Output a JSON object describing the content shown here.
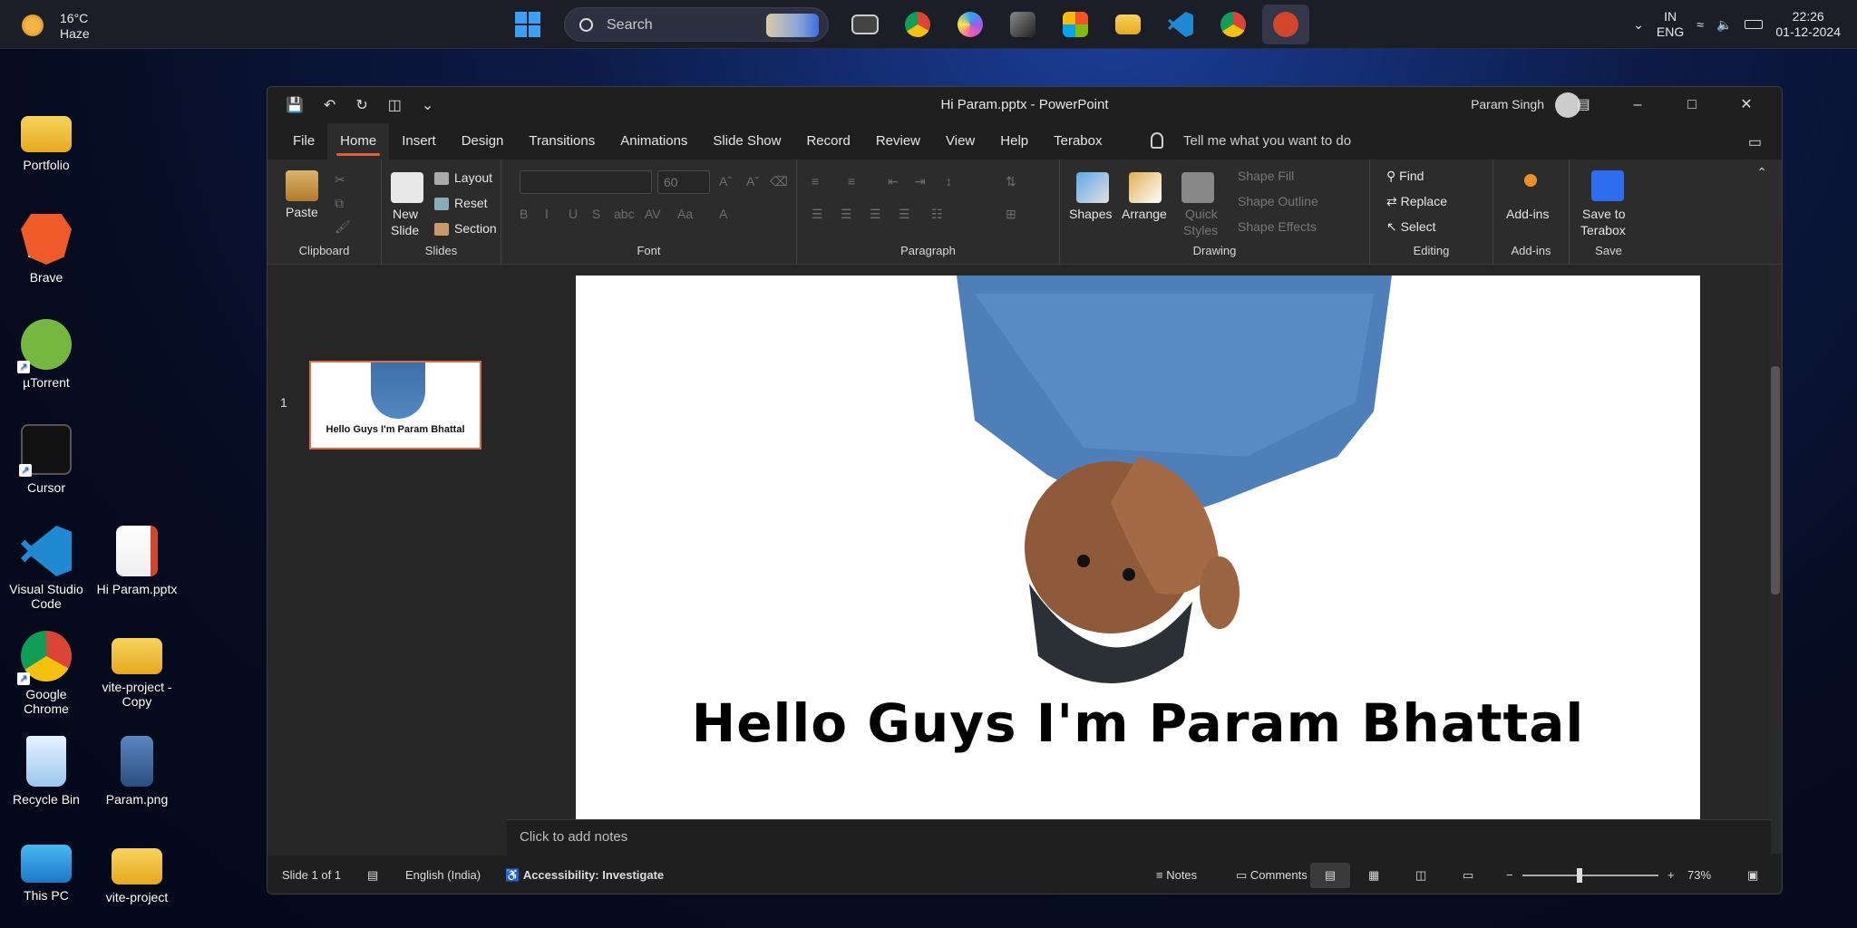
{
  "taskbar": {
    "weather_temp": "16°C",
    "weather_desc": "Haze",
    "search_label": "Search",
    "lang_1": "ENG",
    "lang_2": "IN",
    "time": "22:26",
    "date": "01-12-2024"
  },
  "desktop": {
    "icons": [
      {
        "label": "This PC",
        "icon": "monitor-icon"
      },
      {
        "label": "Recycle Bin",
        "icon": "recycle-bin-icon"
      },
      {
        "label": "Google Chrome",
        "icon": "chrome-icon"
      },
      {
        "label": "Visual Studio Code",
        "icon": "vscode-icon"
      },
      {
        "label": "Cursor",
        "icon": "cursor-icon"
      },
      {
        "label": "µTorrent",
        "icon": "utorrent-icon"
      },
      {
        "label": "Brave",
        "icon": "brave-icon"
      },
      {
        "label": "Portfolio",
        "icon": "folder-icon"
      },
      {
        "label": "vite-project",
        "icon": "folder-icon"
      },
      {
        "label": "Param.png",
        "icon": "image-icon"
      },
      {
        "label": "vite-project - Copy",
        "icon": "folder-icon"
      },
      {
        "label": "Hi Param.pptx",
        "icon": "powerpoint-file-icon"
      }
    ]
  },
  "window": {
    "title": "Hi Param.pptx  -  PowerPoint",
    "user": "Param Singh",
    "menu_tabs": [
      "File",
      "Home",
      "Insert",
      "Design",
      "Transitions",
      "Animations",
      "Slide Show",
      "Record",
      "Review",
      "View",
      "Help",
      "Terabox"
    ],
    "active_tab": "Home",
    "tell_me": "Tell me what you want to do"
  },
  "ribbon": {
    "clipboard": {
      "name": "Clipboard",
      "paste": "Paste"
    },
    "slides": {
      "name": "Slides",
      "new_slide": "New",
      "new_slide2": "Slide",
      "layout": "Layout",
      "reset": "Reset",
      "section": "Section"
    },
    "font": {
      "name": "Font",
      "size": "60"
    },
    "paragraph": {
      "name": "Paragraph"
    },
    "drawing": {
      "name": "Drawing",
      "shapes": "Shapes",
      "arrange": "Arrange",
      "quick_styles": "Quick",
      "quick_styles2": "Styles",
      "shape_fill": "Shape Fill",
      "shape_outline": "Shape Outline",
      "shape_effects": "Shape Effects"
    },
    "editing": {
      "name": "Editing",
      "find": "Find",
      "replace": "Replace",
      "select": "Select"
    },
    "addins": {
      "name": "Add-ins",
      "btn": "Add-ins"
    },
    "save": {
      "name": "Save",
      "btn": "Save to",
      "btn2": "Terabox"
    }
  },
  "slide": {
    "number": "1",
    "headline": "Hello Guys I'm Param Bhattal"
  },
  "notes_placeholder": "Click to add notes",
  "status": {
    "slide_of": "Slide 1 of 1",
    "language": "English (India)",
    "accessibility": "Accessibility: Investigate",
    "notes": "Notes",
    "comments": "Comments",
    "zoom": "73%"
  }
}
